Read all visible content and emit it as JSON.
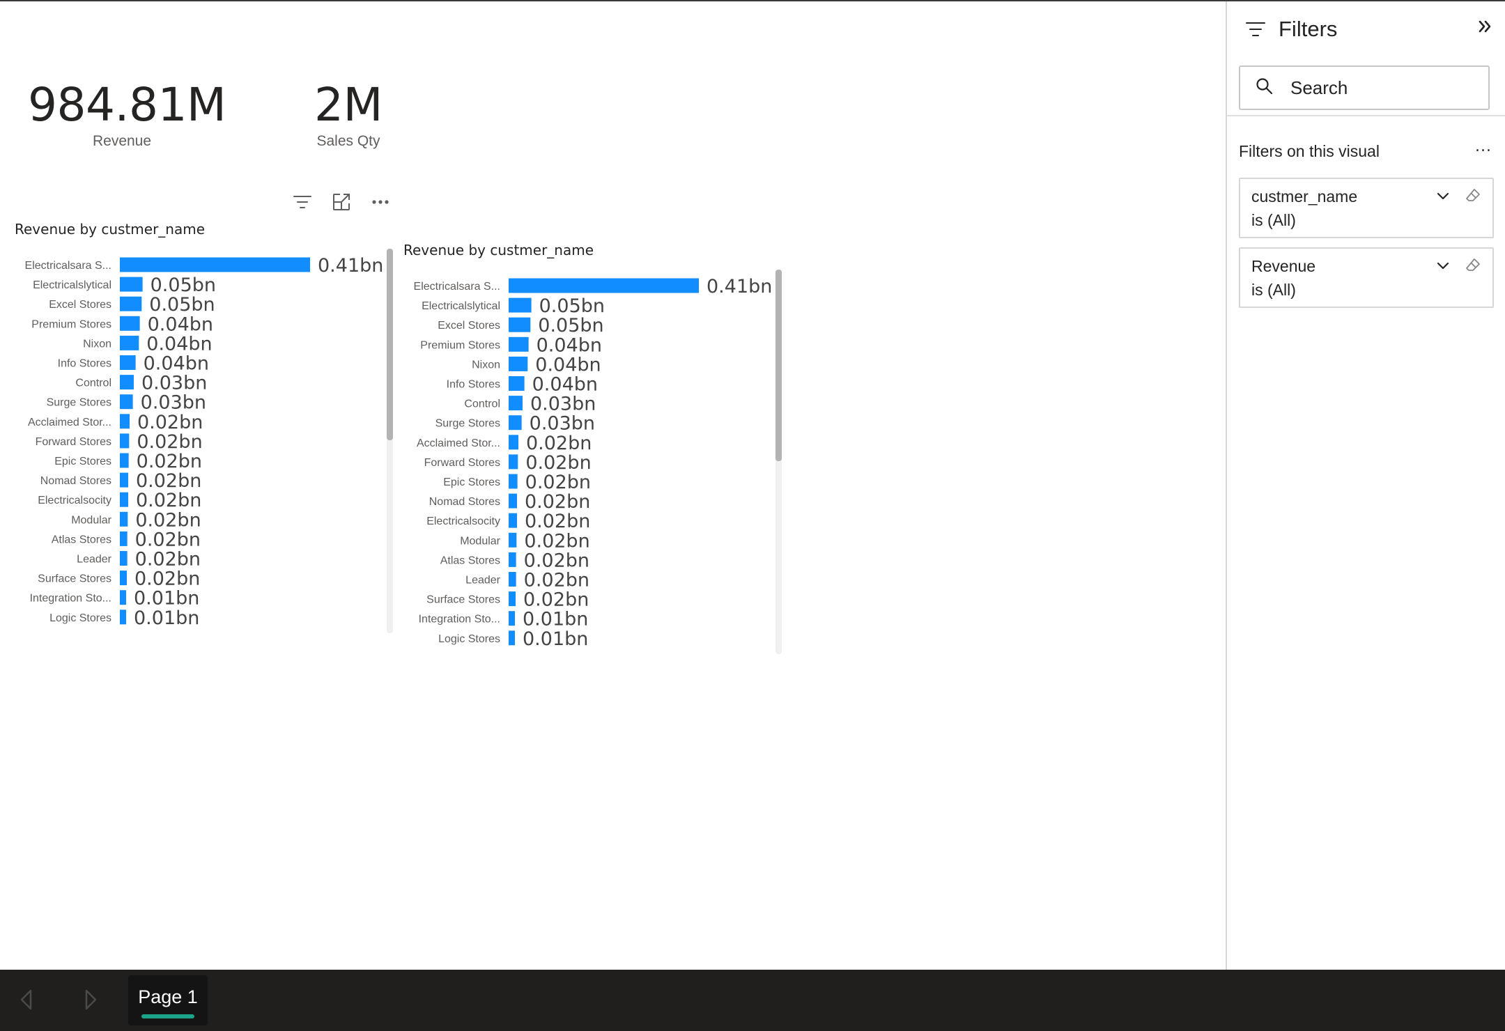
{
  "cards": [
    {
      "value": "984.81M",
      "label": "Revenue"
    },
    {
      "value": "2M",
      "label": "Sales Qty"
    }
  ],
  "charts": [
    {
      "title": "Revenue by custmer_name"
    },
    {
      "title": "Revenue by custmer_name"
    }
  ],
  "chart_data": [
    {
      "type": "bar",
      "orientation": "horizontal",
      "title": "Revenue by custmer_name",
      "categories": [
        "Electricalsara S...",
        "Electricalslytical",
        "Excel Stores",
        "Premium Stores",
        "Nixon",
        "Info Stores",
        "Control",
        "Surge Stores",
        "Acclaimed Stor...",
        "Forward Stores",
        "Epic Stores",
        "Nomad Stores",
        "Electricalsocity",
        "Modular",
        "Atlas Stores",
        "Leader",
        "Surface Stores",
        "Integration Sto...",
        "Logic Stores"
      ],
      "values": [
        0.41,
        0.049,
        0.047,
        0.043,
        0.041,
        0.034,
        0.03,
        0.028,
        0.021,
        0.02,
        0.019,
        0.018,
        0.018,
        0.017,
        0.016,
        0.016,
        0.015,
        0.012,
        0.01
      ],
      "data_labels": [
        "0.41bn",
        "0.05bn",
        "0.05bn",
        "0.04bn",
        "0.04bn",
        "0.04bn",
        "0.03bn",
        "0.03bn",
        "0.02bn",
        "0.02bn",
        "0.02bn",
        "0.02bn",
        "0.02bn",
        "0.02bn",
        "0.02bn",
        "0.02bn",
        "0.02bn",
        "0.01bn",
        "0.01bn"
      ],
      "bar_color": "#118dff",
      "grid": false
    },
    {
      "type": "bar",
      "orientation": "horizontal",
      "title": "Revenue by custmer_name",
      "categories": [
        "Electricalsara S...",
        "Electricalslytical",
        "Excel Stores",
        "Premium Stores",
        "Nixon",
        "Info Stores",
        "Control",
        "Surge Stores",
        "Acclaimed Stor...",
        "Forward Stores",
        "Epic Stores",
        "Nomad Stores",
        "Electricalsocity",
        "Modular",
        "Atlas Stores",
        "Leader",
        "Surface Stores",
        "Integration Sto...",
        "Logic Stores"
      ],
      "values": [
        0.41,
        0.049,
        0.047,
        0.043,
        0.041,
        0.034,
        0.03,
        0.028,
        0.021,
        0.02,
        0.019,
        0.018,
        0.018,
        0.017,
        0.016,
        0.016,
        0.015,
        0.012,
        0.01
      ],
      "data_labels": [
        "0.41bn",
        "0.05bn",
        "0.05bn",
        "0.04bn",
        "0.04bn",
        "0.04bn",
        "0.03bn",
        "0.03bn",
        "0.02bn",
        "0.02bn",
        "0.02bn",
        "0.02bn",
        "0.02bn",
        "0.02bn",
        "0.02bn",
        "0.02bn",
        "0.02bn",
        "0.01bn",
        "0.01bn"
      ],
      "bar_color": "#118dff",
      "grid": false
    }
  ],
  "filters": {
    "title": "Filters",
    "search_placeholder": "Search",
    "section_title": "Filters on this visual",
    "section_more": "...",
    "items": [
      {
        "field": "custmer_name",
        "state": "is (All)"
      },
      {
        "field": "Revenue",
        "state": "is (All)"
      }
    ]
  },
  "pages": {
    "current": "Page 1"
  },
  "icons": {
    "filter": "filter-lines-icon",
    "focus": "focus-mode-icon",
    "more": "more-options-icon",
    "collapse": "double-chevron-right-icon",
    "search": "search-icon",
    "chevron": "chevron-down-icon",
    "eraser": "eraser-icon",
    "prev": "triangle-left-icon",
    "next": "triangle-right-icon"
  },
  "colors": {
    "bar": "#118dff",
    "page_bar": "#201f1e",
    "tab_underline": "#1aa589"
  }
}
